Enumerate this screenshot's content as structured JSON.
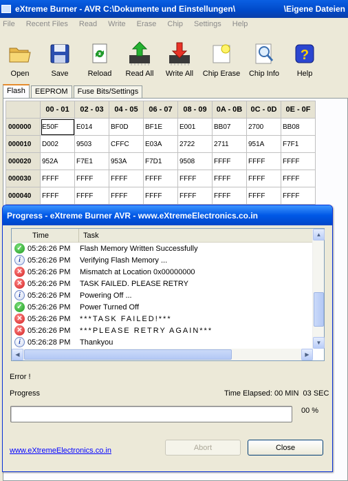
{
  "window": {
    "title": "eXtreme Burner - AVR C:\\Dokumente und Einstellungen\\",
    "title_tail": "\\Eigene Dateien"
  },
  "menu": [
    "File",
    "Recent Files",
    "Read",
    "Write",
    "Erase",
    "Chip",
    "Settings",
    "Help"
  ],
  "toolbar": [
    {
      "id": "open",
      "label": "Open",
      "icon": "folder-icon"
    },
    {
      "id": "save",
      "label": "Save",
      "icon": "floppy-icon"
    },
    {
      "id": "reload",
      "label": "Reload",
      "icon": "reload-icon"
    },
    {
      "id": "read-all",
      "label": "Read All",
      "icon": "chip-read-icon"
    },
    {
      "id": "write-all",
      "label": "Write All",
      "icon": "chip-write-icon"
    },
    {
      "id": "chip-erase",
      "label": "Chip Erase",
      "icon": "eraser-icon"
    },
    {
      "id": "chip-info",
      "label": "Chip Info",
      "icon": "magnifier-icon"
    },
    {
      "id": "help",
      "label": "Help",
      "icon": "help-icon"
    }
  ],
  "tabs": [
    "Flash",
    "EEPROM",
    "Fuse Bits/Settings"
  ],
  "grid": {
    "columns": [
      "00 - 01",
      "02 - 03",
      "04 - 05",
      "06 - 07",
      "08 - 09",
      "0A - 0B",
      "0C - 0D",
      "0E - 0F"
    ],
    "rows": [
      {
        "addr": "000000",
        "cells": [
          "E50F",
          "E014",
          "BF0D",
          "BF1E",
          "E001",
          "BB07",
          "2700",
          "BB08"
        ]
      },
      {
        "addr": "000010",
        "cells": [
          "D002",
          "9503",
          "CFFC",
          "E03A",
          "2722",
          "2711",
          "951A",
          "F7F1"
        ]
      },
      {
        "addr": "000020",
        "cells": [
          "952A",
          "F7E1",
          "953A",
          "F7D1",
          "9508",
          "FFFF",
          "FFFF",
          "FFFF"
        ]
      },
      {
        "addr": "000030",
        "cells": [
          "FFFF",
          "FFFF",
          "FFFF",
          "FFFF",
          "FFFF",
          "FFFF",
          "FFFF",
          "FFFF"
        ]
      },
      {
        "addr": "000040",
        "cells": [
          "FFFF",
          "FFFF",
          "FFFF",
          "FFFF",
          "FFFF",
          "FFFF",
          "FFFF",
          "FFFF"
        ]
      }
    ]
  },
  "dialog": {
    "title": "Progress - eXtreme Burner AVR - www.eXtremeElectronics.co.in",
    "log_columns": [
      "Time",
      "Task"
    ],
    "log": [
      {
        "type": "ok",
        "time": "05:26:26 PM",
        "task": "Flash Memory Written Successfully"
      },
      {
        "type": "info",
        "time": "05:26:26 PM",
        "task": "Verifying Flash Memory ..."
      },
      {
        "type": "err",
        "time": "05:26:26 PM",
        "task": "Mismatch at Location 0x00000000"
      },
      {
        "type": "err",
        "time": "05:26:26 PM",
        "task": "TASK FAILED. PLEASE RETRY"
      },
      {
        "type": "info",
        "time": "05:26:26 PM",
        "task": "Powering Off ..."
      },
      {
        "type": "ok",
        "time": "05:26:26 PM",
        "task": "Power Turned Off"
      },
      {
        "type": "err",
        "time": "05:26:26 PM",
        "task": "***TASK FAILED!***"
      },
      {
        "type": "err",
        "time": "05:26:26 PM",
        "task": "***PLEASE RETRY AGAIN***"
      },
      {
        "type": "info",
        "time": "05:26:28 PM",
        "task": "Thankyou"
      }
    ],
    "status": "Error !",
    "progress_label": "Progress",
    "elapsed": "Time Elapsed: 00 MIN  03 SEC",
    "progress_value": 0,
    "progress_text": "00 %",
    "link": "www.eXtremeElectronics.co.in",
    "abort_label": "Abort",
    "close_label": "Close"
  }
}
